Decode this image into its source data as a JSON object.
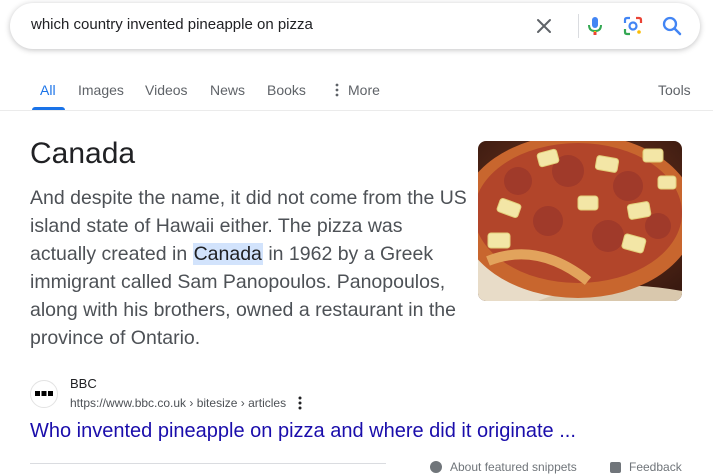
{
  "search": {
    "query": "which country invented pineapple on pizza",
    "icons": [
      "clear-icon",
      "mic-icon",
      "lens-icon",
      "search-icon"
    ]
  },
  "tabs": [
    {
      "label": "All",
      "active": true
    },
    {
      "label": "Images"
    },
    {
      "label": "Videos"
    },
    {
      "label": "News"
    },
    {
      "label": "Books"
    },
    {
      "label": "More"
    }
  ],
  "tools_label": "Tools",
  "featured": {
    "answer": "Canada",
    "snippet_before": "And despite the name, it did not come from the US island state of Hawaii either. The pizza was actually created in ",
    "snippet_highlight": "Canada",
    "snippet_after": " in 1962 by a Greek immigrant called Sam Panopoulos. Panopoulos, along with his brothers, owned a restaurant in the province of Ontario."
  },
  "source": {
    "name": "BBC",
    "url": "https://www.bbc.co.uk › bitesize › articles",
    "title": "Who invented pineapple on pizza and where did it originate ..."
  },
  "footer": {
    "about": "About featured snippets",
    "feedback": "Feedback"
  },
  "colors": {
    "accent": "#1a73e8",
    "link": "#1a0dab",
    "highlight": "#d2e3fc"
  }
}
